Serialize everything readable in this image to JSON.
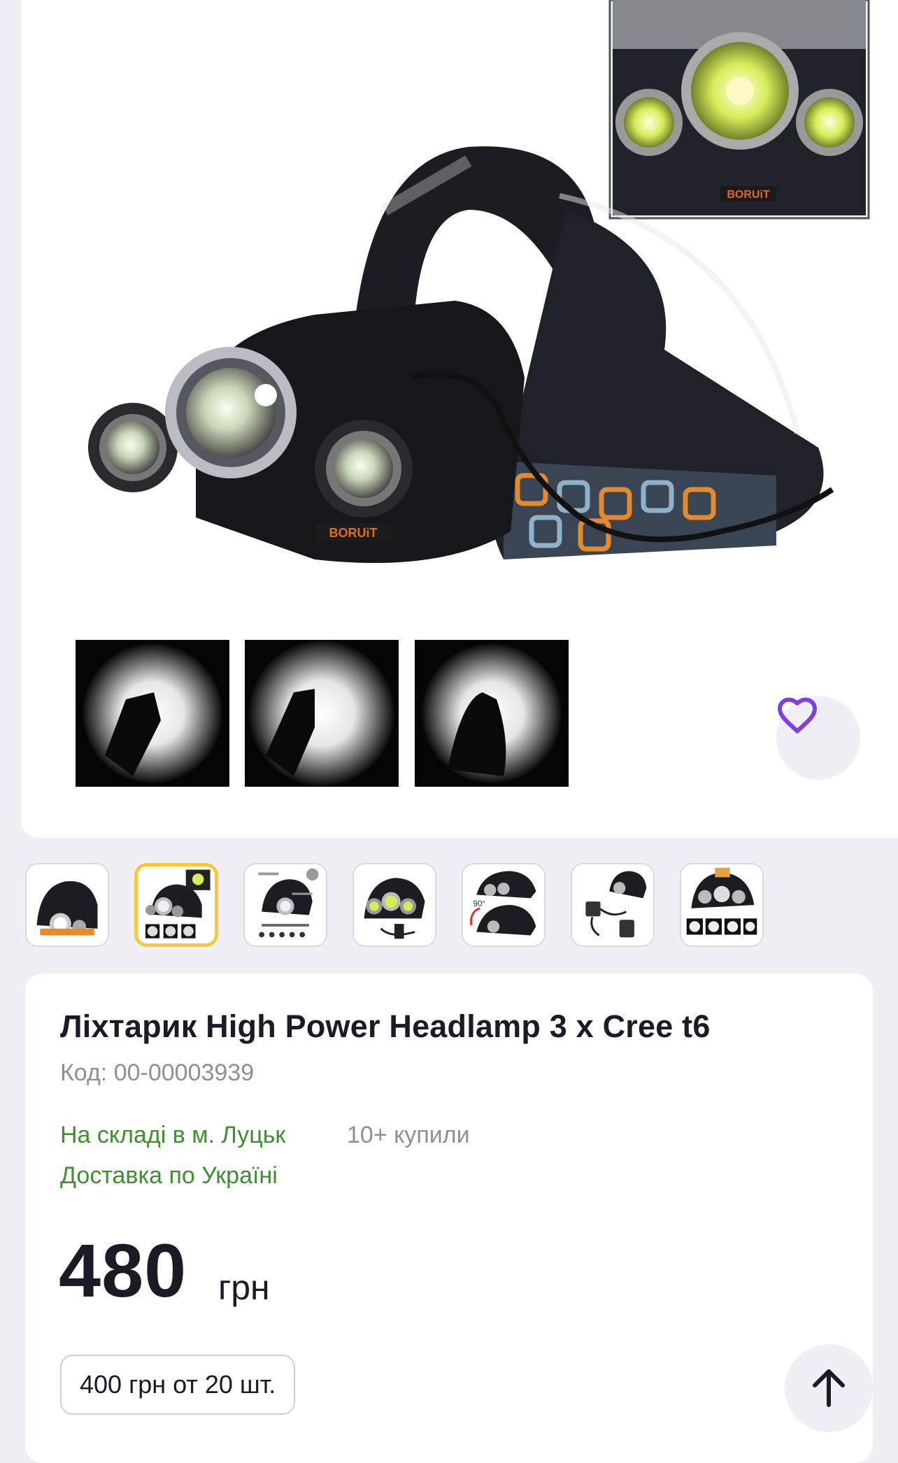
{
  "product": {
    "title": "Ліхтарик High Power Headlamp 3 x Cree t6",
    "code_label": "Код:",
    "code_value": "00-00003939",
    "stock_status": "На складі в м. Луцьк",
    "bought_count": "10+ купили",
    "delivery": "Доставка по Україні",
    "price": "480",
    "currency": "грн",
    "wholesale_price": "400 грн от 20 шт.",
    "brand_marking": "BORUiT"
  },
  "gallery": {
    "thumbnails": [
      {
        "label": "thumbnail-1",
        "active": false
      },
      {
        "label": "thumbnail-2",
        "active": true
      },
      {
        "label": "thumbnail-3",
        "active": false
      },
      {
        "label": "thumbnail-4",
        "active": false
      },
      {
        "label": "thumbnail-5",
        "active": false
      },
      {
        "label": "thumbnail-6",
        "active": false
      },
      {
        "label": "thumbnail-7",
        "active": false
      }
    ],
    "favorite_icon": "heart-outline-icon",
    "scroll_icon": "arrow-up-icon"
  },
  "colors": {
    "accent_purple": "#7b3fe4",
    "stock_green": "#3f8f30",
    "active_thumb_border": "#f5c93a",
    "muted_text": "#8f8e9c"
  }
}
